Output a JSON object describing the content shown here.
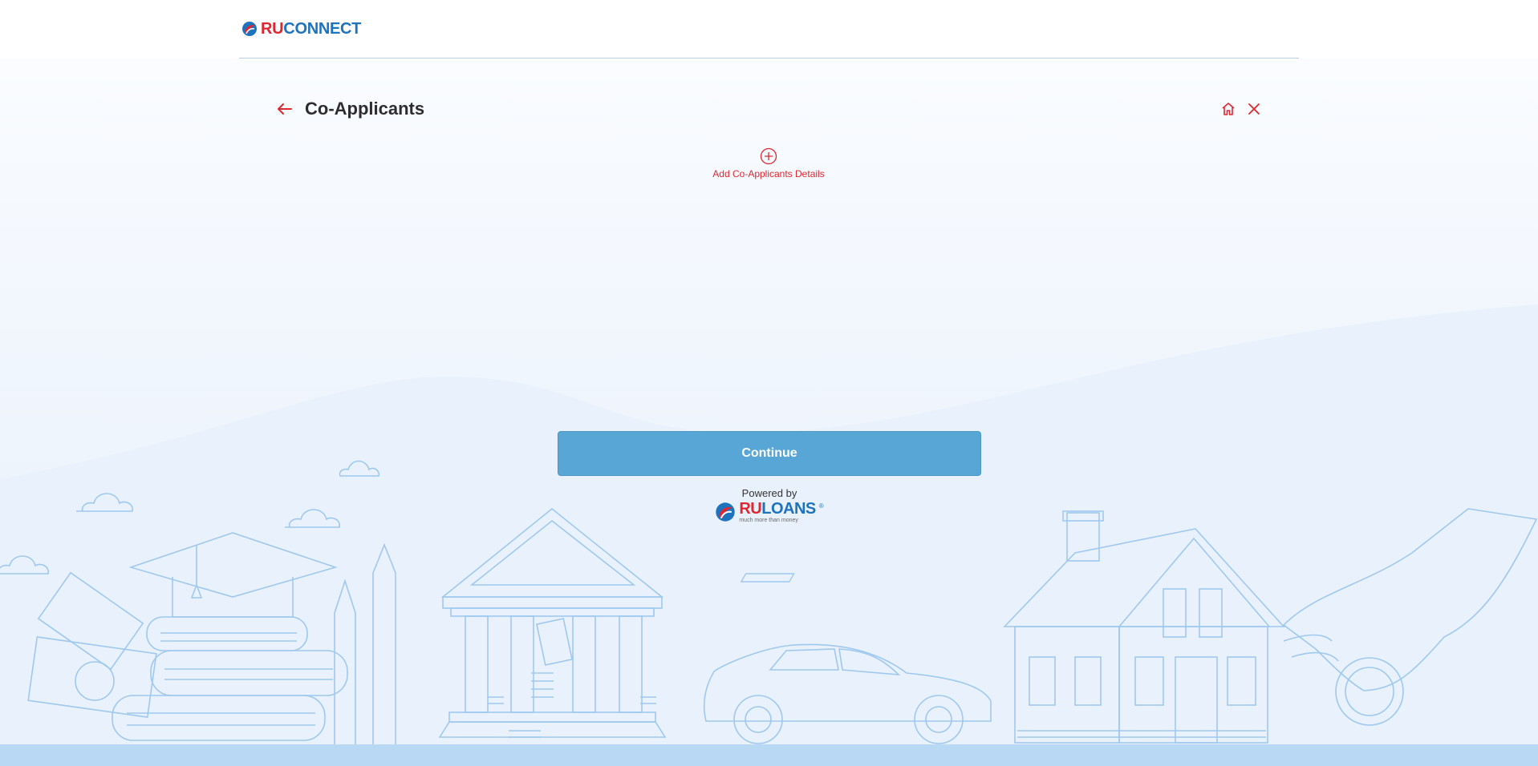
{
  "header": {
    "logo_part1": "RU",
    "logo_part2": "CONNECT"
  },
  "page": {
    "title": "Co-Applicants",
    "add_label": "Add Co-Applicants Details",
    "continue_label": "Continue"
  },
  "footer": {
    "powered_by": "Powered by",
    "brand_part1": "RU",
    "brand_part2": "LOANS",
    "registered_mark": "®",
    "tagline": "much more than money"
  },
  "icons": {
    "back": "arrow-left-icon",
    "home": "home-icon",
    "close": "close-icon",
    "add": "plus-circle-icon"
  },
  "colors": {
    "brand_red": "#e0262f",
    "brand_blue": "#1e73be",
    "button": "#58a6d6",
    "illustration": "#9fc8ee"
  }
}
